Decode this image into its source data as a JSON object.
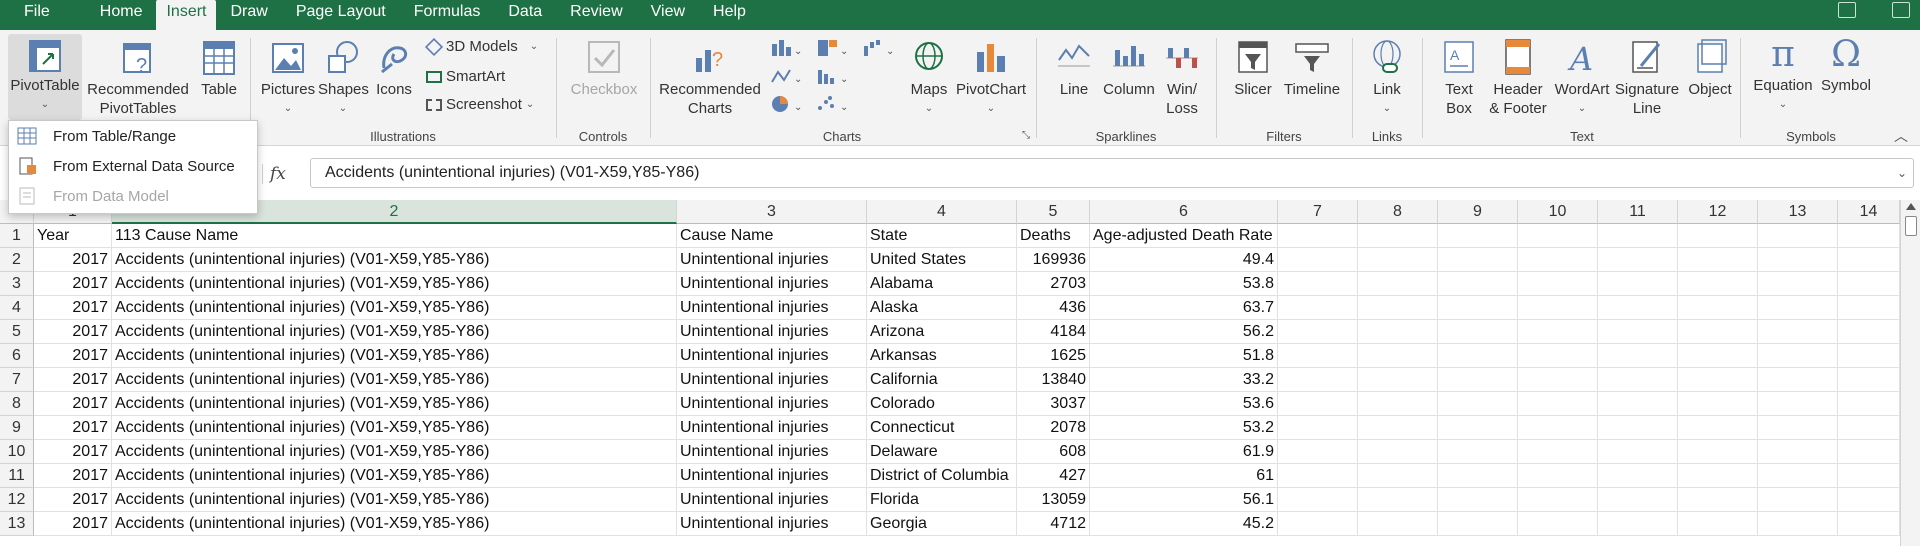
{
  "menu": {
    "tabs": [
      "File",
      "Home",
      "Insert",
      "Draw",
      "Page Layout",
      "Formulas",
      "Data",
      "Review",
      "View",
      "Help"
    ],
    "active": "Insert"
  },
  "ribbon": {
    "tables": {
      "pivottable": "PivotTable",
      "recommended_pivottables_1": "Recommended",
      "recommended_pivottables_2": "PivotTables",
      "table": "Table"
    },
    "illustrations": {
      "label": "Illustrations",
      "pictures": "Pictures",
      "shapes": "Shapes",
      "icons": "Icons",
      "models_3d": "3D Models",
      "smartart": "SmartArt",
      "screenshot": "Screenshot"
    },
    "controls": {
      "label": "Controls",
      "checkbox": "Checkbox"
    },
    "charts": {
      "label": "Charts",
      "recommended_1": "Recommended",
      "recommended_2": "Charts",
      "maps": "Maps",
      "pivotchart": "PivotChart"
    },
    "sparklines": {
      "label": "Sparklines",
      "line": "Line",
      "column": "Column",
      "winloss_1": "Win/",
      "winloss_2": "Loss"
    },
    "filters": {
      "label": "Filters",
      "slicer": "Slicer",
      "timeline": "Timeline"
    },
    "links": {
      "label": "Links",
      "link": "Link"
    },
    "text": {
      "label": "Text",
      "textbox_1": "Text",
      "textbox_2": "Box",
      "header_1": "Header",
      "header_2": "& Footer",
      "wordart": "WordArt",
      "signature_1": "Signature",
      "signature_2": "Line",
      "object": "Object"
    },
    "symbols": {
      "label": "Symbols",
      "equation": "Equation",
      "symbol": "Symbol"
    }
  },
  "pivot_dropdown": {
    "items": [
      "From Table/Range",
      "From External Data Source",
      "From Data Model"
    ]
  },
  "formula_bar": {
    "fx": "fx",
    "value": "Accidents (unintentional injuries) (V01-X59,Y85-Y86)"
  },
  "grid": {
    "columns": [
      "1",
      "2",
      "3",
      "4",
      "5",
      "6",
      "7",
      "8",
      "9",
      "10",
      "11",
      "12",
      "13",
      "14"
    ],
    "rows": [
      [
        "1",
        "Year",
        "113 Cause Name",
        "Cause Name",
        "State",
        "Deaths",
        "Age-adjusted Death Rate"
      ],
      [
        "2",
        "2017",
        "Accidents (unintentional injuries) (V01-X59,Y85-Y86)",
        "Unintentional injuries",
        "United States",
        "169936",
        "49.4"
      ],
      [
        "3",
        "2017",
        "Accidents (unintentional injuries) (V01-X59,Y85-Y86)",
        "Unintentional injuries",
        "Alabama",
        "2703",
        "53.8"
      ],
      [
        "4",
        "2017",
        "Accidents (unintentional injuries) (V01-X59,Y85-Y86)",
        "Unintentional injuries",
        "Alaska",
        "436",
        "63.7"
      ],
      [
        "5",
        "2017",
        "Accidents (unintentional injuries) (V01-X59,Y85-Y86)",
        "Unintentional injuries",
        "Arizona",
        "4184",
        "56.2"
      ],
      [
        "6",
        "2017",
        "Accidents (unintentional injuries) (V01-X59,Y85-Y86)",
        "Unintentional injuries",
        "Arkansas",
        "1625",
        "51.8"
      ],
      [
        "7",
        "2017",
        "Accidents (unintentional injuries) (V01-X59,Y85-Y86)",
        "Unintentional injuries",
        "California",
        "13840",
        "33.2"
      ],
      [
        "8",
        "2017",
        "Accidents (unintentional injuries) (V01-X59,Y85-Y86)",
        "Unintentional injuries",
        "Colorado",
        "3037",
        "53.6"
      ],
      [
        "9",
        "2017",
        "Accidents (unintentional injuries) (V01-X59,Y85-Y86)",
        "Unintentional injuries",
        "Connecticut",
        "2078",
        "53.2"
      ],
      [
        "10",
        "2017",
        "Accidents (unintentional injuries) (V01-X59,Y85-Y86)",
        "Unintentional injuries",
        "Delaware",
        "608",
        "61.9"
      ],
      [
        "11",
        "2017",
        "Accidents (unintentional injuries) (V01-X59,Y85-Y86)",
        "Unintentional injuries",
        "District of Columbia",
        "427",
        "61"
      ],
      [
        "12",
        "2017",
        "Accidents (unintentional injuries) (V01-X59,Y85-Y86)",
        "Unintentional injuries",
        "Florida",
        "13059",
        "56.1"
      ],
      [
        "13",
        "2017",
        "Accidents (unintentional injuries) (V01-X59,Y85-Y86)",
        "Unintentional injuries",
        "Georgia",
        "4712",
        "45.2"
      ]
    ]
  },
  "colors": {
    "accent": "#1e7145",
    "ribbon_bg": "#f3f3f3",
    "selected_col": "#d9e4dc"
  }
}
